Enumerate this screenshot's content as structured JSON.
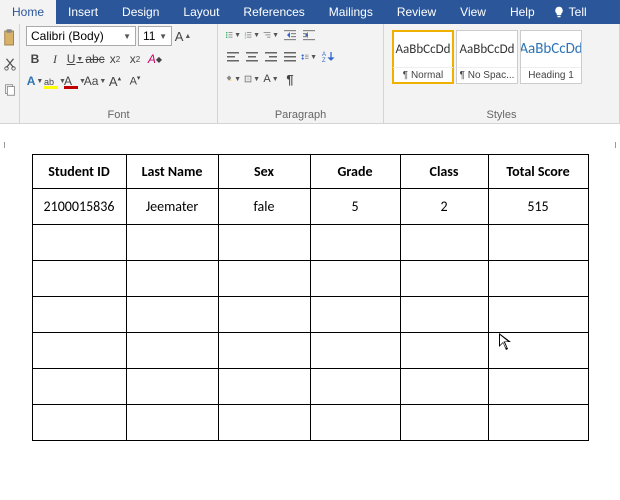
{
  "tabs": {
    "home": "Home",
    "insert": "Insert",
    "design": "Design",
    "layout": "Layout",
    "references": "References",
    "mailings": "Mailings",
    "review": "Review",
    "view": "View",
    "help": "Help",
    "tell": "Tell"
  },
  "font": {
    "name": "Calibri (Body)",
    "size": "11",
    "group_label": "Font"
  },
  "paragraph": {
    "group_label": "Paragraph"
  },
  "styles": {
    "group_label": "Styles",
    "preview_text": "AaBbCcDd",
    "items": [
      {
        "name": "¶ Normal"
      },
      {
        "name": "¶ No Spac..."
      },
      {
        "name": "Heading 1"
      }
    ]
  },
  "table": {
    "headers": [
      "Student ID",
      "Last Name",
      "Sex",
      "Grade",
      "Class",
      "Total Score"
    ],
    "rows": [
      [
        "2100015836",
        "Jeemater",
        "fale",
        "5",
        "2",
        "515"
      ],
      [
        "",
        "",
        "",
        "",
        "",
        ""
      ],
      [
        "",
        "",
        "",
        "",
        "",
        ""
      ],
      [
        "",
        "",
        "",
        "",
        "",
        ""
      ],
      [
        "",
        "",
        "",
        "",
        "",
        ""
      ],
      [
        "",
        "",
        "",
        "",
        "",
        ""
      ],
      [
        "",
        "",
        "",
        "",
        "",
        ""
      ]
    ]
  }
}
